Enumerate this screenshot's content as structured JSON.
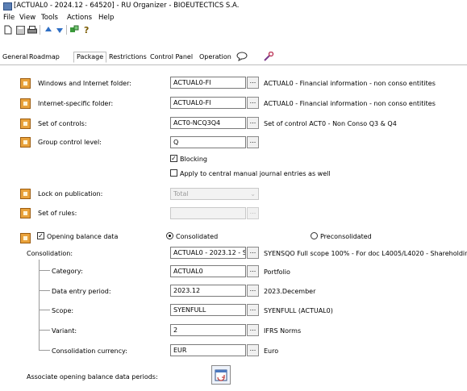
{
  "window": {
    "title": "[ACTUAL0 - 2024.12 - 64520] - RU Organizer - BIOEUTECTICS S.A."
  },
  "menu": [
    "File",
    "View",
    "Tools",
    "Actions",
    "Help"
  ],
  "toolbar_icons": [
    "new-icon",
    "save-icon",
    "print-icon",
    "up-arrow-icon",
    "down-arrow-icon",
    "green-node-icon",
    "help-icon"
  ],
  "tabs": [
    "General",
    "Roadmap",
    "Package",
    "Restrictions",
    "Control Panel",
    "Operation"
  ],
  "active_tab": "Package",
  "rows": {
    "windows_folder": {
      "label": "Windows and Internet folder:",
      "value": "ACTUAL0-FI",
      "desc": "ACTUAL0 - Financial information - non conso entitites"
    },
    "internet_folder": {
      "label": "Internet-specific folder:",
      "value": "ACTUAL0-FI",
      "desc": "ACTUAL0 - Financial information - non conso entitites"
    },
    "controls": {
      "label": "Set of controls:",
      "value": "ACT0-NCQ3Q4",
      "desc": "Set of control ACT0 - Non Conso Q3 & Q4"
    },
    "group_control": {
      "label": "Group control level:",
      "value": "Q"
    },
    "blocking": {
      "label": "Blocking",
      "checked": true
    },
    "apply_manual": {
      "label": "Apply to central manual journal entries as well",
      "checked": false
    },
    "lock": {
      "label": "Lock on publication:",
      "value": "Total"
    },
    "rules": {
      "label": "Set of rules:",
      "value": ""
    }
  },
  "opening": {
    "label": "Opening balance data",
    "checked": true,
    "consolidated": "Consolidated",
    "preconsolidated": "Preconsolidated",
    "selected": "Consolidated",
    "consolidation": {
      "label": "Consolidation:",
      "value": "ACTUAL0 - 2023.12 - S",
      "desc": "SYENSQO Full scope 100% - For doc L4005/L4020 - Shareholding st"
    },
    "category": {
      "label": "Category:",
      "value": "ACTUAL0",
      "desc": "Portfolio"
    },
    "period": {
      "label": "Data entry period:",
      "value": "2023.12",
      "desc": "2023.December"
    },
    "scope": {
      "label": "Scope:",
      "value": "SYENFULL",
      "desc": "SYENFULL (ACTUAL0)"
    },
    "variant": {
      "label": "Variant:",
      "value": "2",
      "desc": "IFRS Norms"
    },
    "currency": {
      "label": "Consolidation currency:",
      "value": "EUR",
      "desc": "Euro"
    },
    "associate": {
      "label": "Associate opening balance data periods:"
    }
  },
  "ellipsis": "...",
  "colors": {
    "icon": "#e9a23b",
    "border": "#7a7a7a",
    "disabled": "#f2f2f2"
  }
}
